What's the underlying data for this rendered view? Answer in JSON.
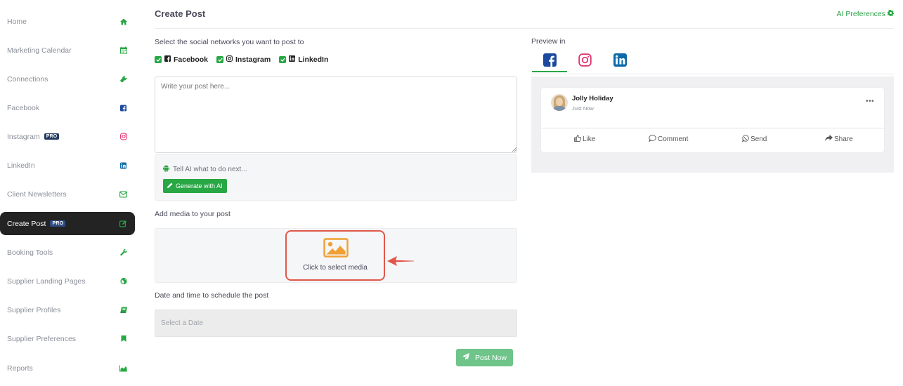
{
  "sidebar": {
    "items": [
      {
        "label": "Home",
        "icon": "home-icon",
        "active": false
      },
      {
        "label": "Marketing Calendar",
        "icon": "calendar-icon",
        "active": false
      },
      {
        "label": "Connections",
        "icon": "plug-icon",
        "active": false
      },
      {
        "label": "Facebook",
        "icon": "facebook-icon",
        "active": false
      },
      {
        "label": "Instagram",
        "icon": "instagram-icon",
        "badge": "PRO",
        "active": false
      },
      {
        "label": "LinkedIn",
        "icon": "linkedin-icon",
        "active": false
      },
      {
        "label": "Client Newsletters",
        "icon": "envelope-icon",
        "active": false
      },
      {
        "label": "Create Post",
        "icon": "edit-icon",
        "badge": "PRO",
        "active": true
      },
      {
        "label": "Booking Tools",
        "icon": "wrench-icon",
        "active": false
      },
      {
        "label": "Supplier Landing Pages",
        "icon": "globe-icon",
        "active": false
      },
      {
        "label": "Supplier Profiles",
        "icon": "book-icon",
        "active": false
      },
      {
        "label": "Supplier Preferences",
        "icon": "bookmark-icon",
        "active": false
      },
      {
        "label": "Reports",
        "icon": "area-chart-icon",
        "active": false
      }
    ]
  },
  "header": {
    "title": "Create Post",
    "ai_preferences": "AI Preferences"
  },
  "networks": {
    "label": "Select the social networks you want to post to",
    "options": [
      {
        "label": "Facebook",
        "checked": true
      },
      {
        "label": "Instagram",
        "checked": true
      },
      {
        "label": "LinkedIn",
        "checked": true
      }
    ]
  },
  "post": {
    "placeholder": "Write your post here..."
  },
  "ai": {
    "hint": "Tell AI what to do next...",
    "button": "Generate with AI"
  },
  "media": {
    "label": "Add media to your post",
    "select": "Click to select media"
  },
  "schedule": {
    "label": "Date and time to schedule the post",
    "placeholder": "Select a Date"
  },
  "post_now": "Post Now",
  "preview": {
    "label": "Preview in",
    "tabs": [
      "facebook-icon",
      "instagram-icon",
      "linkedin-icon"
    ],
    "active_tab": "facebook",
    "card": {
      "name": "Jolly Holiday",
      "time": "Just Now",
      "more": "•••",
      "actions": [
        "Like",
        "Comment",
        "Send",
        "Share"
      ]
    }
  },
  "colors": {
    "accent": "#28a745",
    "sidebar_active": "#232323",
    "highlight": "#e0574a",
    "pro_badge": "#233a62"
  }
}
